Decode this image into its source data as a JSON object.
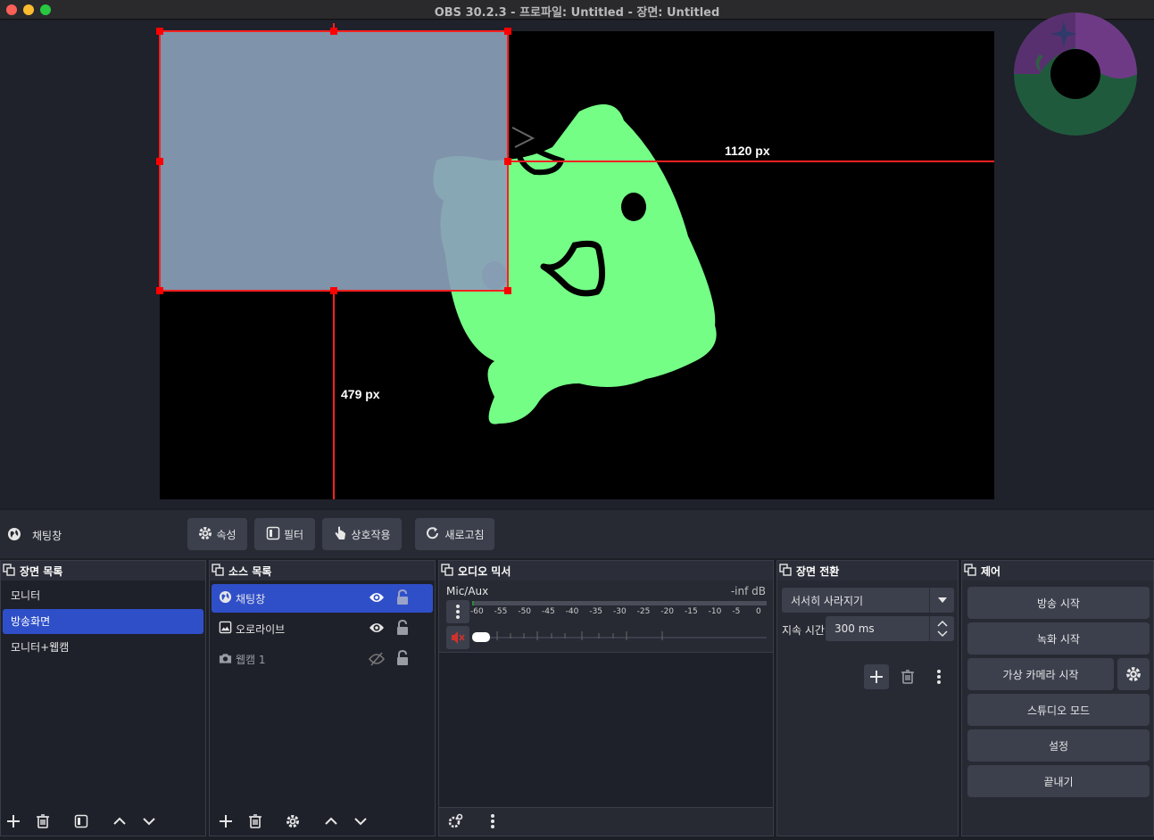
{
  "window": {
    "title": "OBS 30.2.3 - 프로파일: Untitled - 장면: Untitled"
  },
  "preview": {
    "measure_horizontal": "1120 px",
    "measure_vertical": "479 px"
  },
  "context_bar": {
    "source_name": "채팅창",
    "properties_label": "속성",
    "filters_label": "필터",
    "interact_label": "상호작용",
    "refresh_label": "새로고침"
  },
  "scenes": {
    "title": "장면 목록",
    "items": [
      {
        "label": "모니터",
        "selected": false
      },
      {
        "label": "방송화면",
        "selected": true
      },
      {
        "label": "모니터+웹캠",
        "selected": false
      }
    ]
  },
  "sources": {
    "title": "소스 목록",
    "items": [
      {
        "label": "채팅창",
        "icon": "browser-icon",
        "visible": true,
        "locked": false,
        "selected": true
      },
      {
        "label": "오로라이브",
        "icon": "image-icon",
        "visible": true,
        "locked": false,
        "selected": false
      },
      {
        "label": "웹캠 1",
        "icon": "camera-icon",
        "visible": false,
        "locked": false,
        "selected": false
      }
    ]
  },
  "mixer": {
    "title": "오디오 믹서",
    "channel_name": "Mic/Aux",
    "level": "-inf dB",
    "ticks": [
      "-60",
      "-55",
      "-50",
      "-45",
      "-40",
      "-35",
      "-30",
      "-25",
      "-20",
      "-15",
      "-10",
      "-5",
      "0"
    ],
    "muted": true,
    "volume": 0
  },
  "transitions": {
    "title": "장면 전환",
    "selected": "서서히 사라지기",
    "duration_label": "지속 시간",
    "duration_value": "300 ms"
  },
  "controls": {
    "title": "제어",
    "start_streaming": "방송 시작",
    "start_recording": "녹화 시작",
    "start_virtualcam": "가상 카메라 시작",
    "studio_mode": "스튜디오 모드",
    "settings": "설정",
    "exit": "끝내기"
  },
  "colors": {
    "selection": "#2f4fc9",
    "button": "#3c404d",
    "panel": "#272a33",
    "list_bg": "#1f212a",
    "transform_handle": "#ff0000",
    "mascot_green": "#74fe86",
    "source_fill": "#7f95ae"
  }
}
